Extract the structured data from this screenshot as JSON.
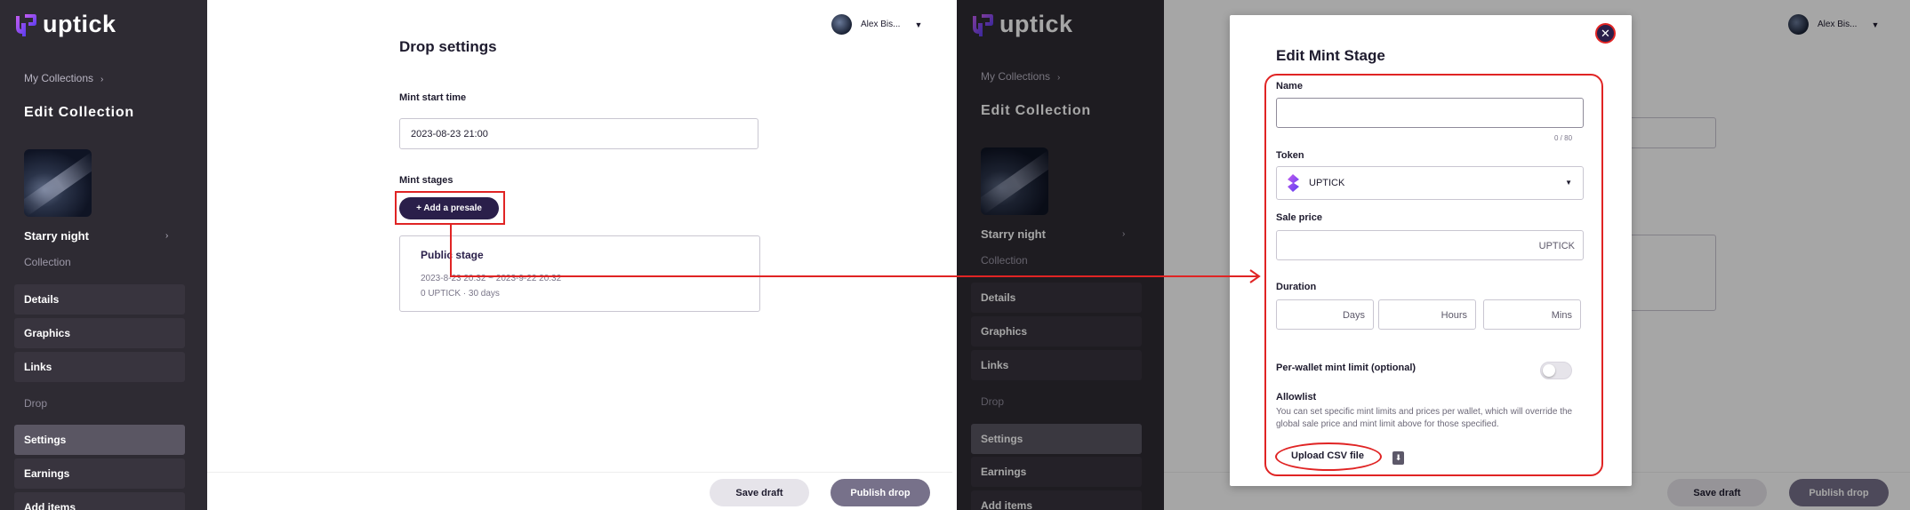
{
  "brand": {
    "name": "uptick",
    "accent": "#2a1f4a",
    "highlight": "#e02424"
  },
  "sidebar": {
    "breadcrumb": "My Collections",
    "title": "Edit Collection",
    "collection_name": "Starry night",
    "collection_type": "Collection",
    "items": [
      {
        "label": "Details"
      },
      {
        "label": "Graphics"
      },
      {
        "label": "Links"
      },
      {
        "section": "Drop"
      },
      {
        "label": "Settings",
        "active": true
      },
      {
        "label": "Earnings"
      },
      {
        "label": "Add items"
      }
    ]
  },
  "header": {
    "user_name": "Alex Bis..."
  },
  "drop_settings": {
    "title": "Drop settings",
    "mint_start_label": "Mint start time",
    "mint_start_value": "2023-08-23 21:00",
    "mint_stages_label": "Mint stages",
    "add_presale_label": "+ Add a presale",
    "stage": {
      "title": "Public stage",
      "range": "2023-8-23 20:32 ~ 2023-9-22 20:32",
      "sub": "0 UPTICK · 30 days"
    }
  },
  "footer": {
    "save_label": "Save draft",
    "publish_label": "Publish drop"
  },
  "modal": {
    "title": "Edit Mint Stage",
    "close_icon": "close-icon",
    "name_label": "Name",
    "name_counter": "0 / 80",
    "token_label": "Token",
    "token_value": "UPTICK",
    "sale_price_label": "Sale price",
    "sale_price_suffix": "UPTICK",
    "duration_label": "Duration",
    "duration_units": [
      "Days",
      "Hours",
      "Mins"
    ],
    "mint_limit_label": "Per-wallet mint limit (optional)",
    "allowlist_label": "Allowlist",
    "allowlist_desc": "You can set specific mint limits and prices per wallet, which will override the global sale price and mint limit above for those specified.",
    "upload_label": "Upload CSV file"
  }
}
